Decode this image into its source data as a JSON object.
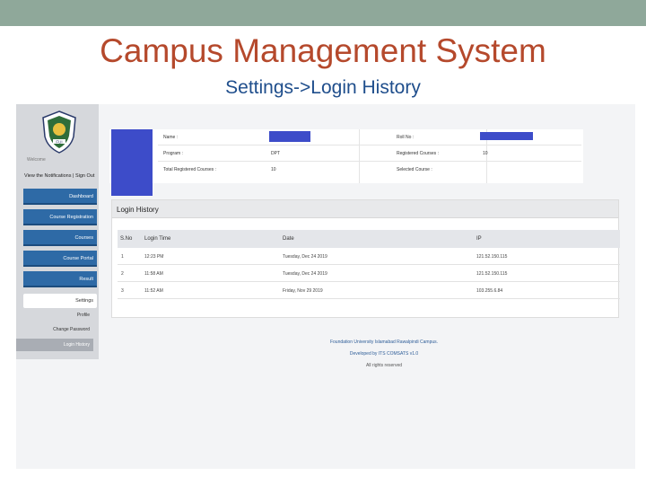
{
  "slide": {
    "title": "Campus Management System",
    "subtitle": "Settings->Login History"
  },
  "colors": {
    "title": "#b5492c",
    "subtitle": "#1f4e8c",
    "nav_button": "#2e6aa6",
    "redaction": "#3d4cc9",
    "top_band": "#8fa89a"
  },
  "sidebar": {
    "logo_text": "FUI",
    "welcome": "Welcome",
    "notifications": "View the Notifications",
    "separator": "|",
    "sign_out": "Sign Out",
    "nav": [
      "Dashboard",
      "Course Registration",
      "Courses",
      "Course Portal",
      "Result"
    ],
    "settings": "Settings",
    "sub_items": [
      "Profile",
      "Change Password",
      "Login History"
    ]
  },
  "student_info": {
    "name_label": "Name :",
    "roll_label": "Roll No :",
    "program_label": "Program :",
    "program_value": "DPT",
    "registered_label": "Registered Courses :",
    "registered_value": "10",
    "total_label": "Total Registered Courses :",
    "total_value": "10",
    "selected_label": "Selected Course :"
  },
  "login_history": {
    "title": "Login History",
    "columns": [
      "S.No",
      "Login Time",
      "Date",
      "IP"
    ],
    "rows": [
      [
        "1",
        "12:23 PM",
        "Tuesday, Dec 24 2019",
        "121.52.150.115"
      ],
      [
        "2",
        "11:58 AM",
        "Tuesday, Dec 24 2019",
        "121.52.150.115"
      ],
      [
        "3",
        "11:52 AM",
        "Friday, Nov 29 2019",
        "103.255.6.84"
      ]
    ]
  },
  "footer": {
    "line1": "Foundation University Islamabad Rawalpindi Campus.",
    "line2": "Developed by ITS COMSATS v1.0",
    "line3": "All rights reserved"
  }
}
